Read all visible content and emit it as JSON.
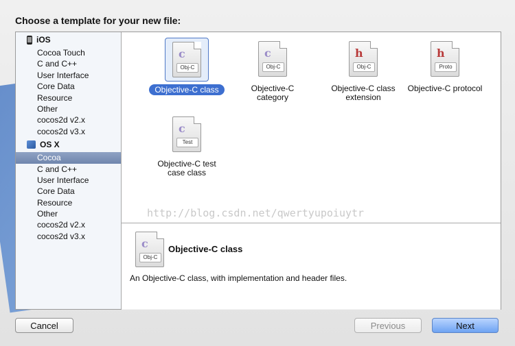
{
  "title": "Choose a template for your new file:",
  "sidebar": {
    "sections": [
      {
        "label": "iOS",
        "items": [
          "Cocoa Touch",
          "C and C++",
          "User Interface",
          "Core Data",
          "Resource",
          "Other",
          "cocos2d v2.x",
          "cocos2d v3.x"
        ]
      },
      {
        "label": "OS X",
        "items": [
          "Cocoa",
          "C and C++",
          "User Interface",
          "Core Data",
          "Resource",
          "Other",
          "cocos2d v2.x",
          "cocos2d v3.x"
        ]
      }
    ],
    "selected": "Cocoa"
  },
  "templates": [
    {
      "label": "Objective-C class",
      "tag": "Obj-C",
      "letter": "c"
    },
    {
      "label": "Objective-C category",
      "tag": "Obj-C",
      "letter": "c"
    },
    {
      "label": "Objective-C class extension",
      "tag": "Obj-C",
      "letter": "h"
    },
    {
      "label": "Objective-C protocol",
      "tag": "Proto",
      "letter": "h"
    },
    {
      "label": "Objective-C test case class",
      "tag": "Test",
      "letter": "c"
    }
  ],
  "selected_template": "Objective-C class",
  "detail": {
    "title": "Objective-C class",
    "tag": "Obj-C",
    "letter": "c",
    "description": "An Objective-C class, with implementation and header files."
  },
  "watermark": "http://blog.csdn.net/qwertyupoiuytr",
  "buttons": {
    "cancel": "Cancel",
    "previous": "Previous",
    "next": "Next"
  }
}
